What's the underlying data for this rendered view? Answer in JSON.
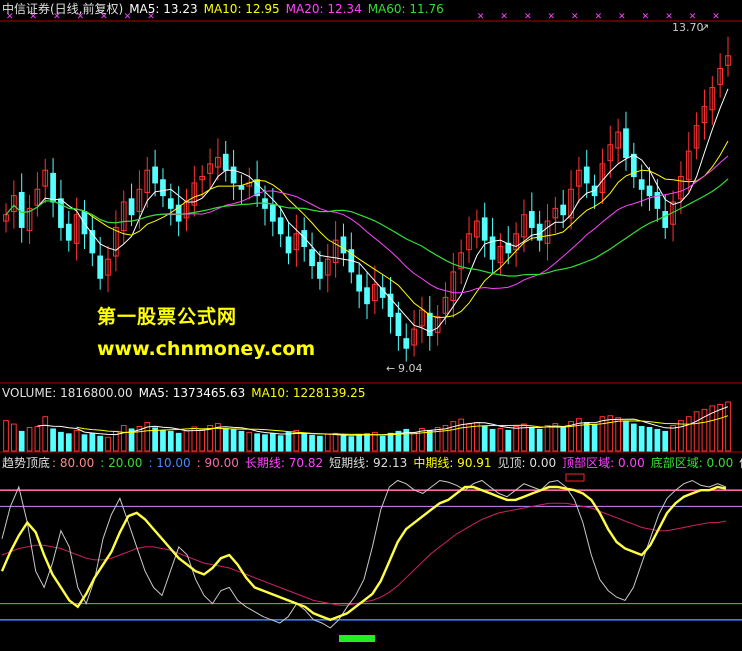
{
  "colors": {
    "bg": "#000000",
    "up": "#ff3333",
    "down": "#54ffff",
    "ma5": "#ffffff",
    "ma10": "#ffff00",
    "ma20": "#ff44ff",
    "ma60": "#33dd33",
    "divider": "#b00000"
  },
  "price_header": {
    "title": "中信证券(日线,前复权)",
    "ma5": "MA5: 13.23",
    "ma10": "MA10: 12.95",
    "ma20": "MA20: 12.34",
    "ma60": "MA60: 11.76"
  },
  "volume_header": {
    "title": "VOLUME: 1816800.00",
    "ma5": "MA5: 1373465.63",
    "ma10": "MA10: 1228139.25"
  },
  "indicator_header": {
    "title": "趋势顶底",
    "v1": ": 80.00",
    "v2": ": 20.00",
    "v3": ": 10.00",
    "v4": ": 90.00",
    "long": "长期线: 70.82",
    "short": "短期线: 92.13",
    "mid": "中期线: 90.91",
    "top": "见顶: 0.00",
    "top_zone": "顶部区域: 0.00",
    "bottom_zone": "底部区域: 0.00",
    "low": "低位"
  },
  "watermark": {
    "line1": "第一股票公式网",
    "line2": "www.chnmoney.com"
  },
  "chart_data": [
    {
      "type": "candlestick",
      "ylim": [
        8.6,
        14.2
      ],
      "max_label": "13.70",
      "min_label": "9.04",
      "close": [
        11.2,
        11.5,
        11.0,
        11.3,
        11.6,
        11.9,
        11.4,
        11.0,
        10.8,
        11.2,
        10.9,
        10.6,
        10.2,
        10.5,
        11.0,
        11.4,
        11.2,
        11.6,
        11.9,
        11.7,
        11.5,
        11.3,
        11.1,
        11.4,
        11.7,
        11.8,
        12.0,
        12.1,
        11.9,
        11.7,
        11.6,
        11.7,
        11.5,
        11.3,
        11.1,
        10.9,
        10.6,
        10.9,
        10.7,
        10.4,
        10.2,
        10.5,
        10.8,
        10.6,
        10.3,
        10.0,
        9.8,
        10.1,
        9.9,
        9.6,
        9.3,
        9.1,
        9.4,
        9.7,
        9.3,
        9.6,
        9.9,
        10.3,
        10.6,
        10.9,
        11.1,
        10.8,
        10.5,
        10.7,
        10.6,
        10.9,
        11.2,
        11.0,
        10.8,
        11.1,
        11.3,
        11.2,
        11.6,
        11.9,
        11.7,
        11.5,
        12.0,
        12.3,
        12.5,
        12.1,
        11.8,
        11.6,
        11.5,
        11.3,
        11.0,
        11.4,
        11.8,
        12.2,
        12.6,
        12.9,
        13.2,
        13.5,
        13.7
      ]
    },
    {
      "type": "bar",
      "values": [
        0.62,
        0.55,
        0.4,
        0.48,
        0.5,
        0.7,
        0.45,
        0.38,
        0.35,
        0.42,
        0.33,
        0.36,
        0.3,
        0.28,
        0.4,
        0.52,
        0.45,
        0.5,
        0.58,
        0.47,
        0.42,
        0.4,
        0.36,
        0.41,
        0.49,
        0.44,
        0.52,
        0.56,
        0.46,
        0.43,
        0.4,
        0.38,
        0.35,
        0.33,
        0.36,
        0.31,
        0.38,
        0.42,
        0.35,
        0.32,
        0.3,
        0.34,
        0.36,
        0.31,
        0.29,
        0.33,
        0.35,
        0.38,
        0.3,
        0.36,
        0.4,
        0.44,
        0.38,
        0.46,
        0.42,
        0.48,
        0.52,
        0.6,
        0.65,
        0.55,
        0.58,
        0.5,
        0.44,
        0.46,
        0.42,
        0.5,
        0.55,
        0.48,
        0.44,
        0.52,
        0.56,
        0.5,
        0.6,
        0.66,
        0.58,
        0.54,
        0.7,
        0.72,
        0.68,
        0.6,
        0.55,
        0.5,
        0.48,
        0.44,
        0.4,
        0.52,
        0.62,
        0.7,
        0.8,
        0.85,
        0.92,
        0.95,
        1.0
      ]
    },
    {
      "type": "line",
      "ylim": [
        0,
        100
      ],
      "levels": [
        90,
        80,
        20,
        10
      ],
      "mid": [
        40,
        52,
        62,
        70,
        64,
        50,
        38,
        30,
        22,
        18,
        26,
        36,
        44,
        52,
        64,
        74,
        76,
        72,
        66,
        60,
        54,
        48,
        44,
        40,
        38,
        42,
        48,
        50,
        44,
        36,
        30,
        28,
        26,
        24,
        22,
        20,
        18,
        14,
        12,
        10,
        12,
        14,
        18,
        22,
        26,
        34,
        46,
        58,
        66,
        70,
        74,
        78,
        82,
        84,
        88,
        92,
        92,
        90,
        88,
        86,
        84,
        84,
        86,
        88,
        90,
        92,
        92,
        91,
        90,
        88,
        84,
        76,
        66,
        58,
        54,
        52,
        50,
        56,
        66,
        76,
        82,
        86,
        88,
        90,
        90,
        92,
        91
      ],
      "short": [
        60,
        80,
        92,
        70,
        40,
        30,
        45,
        65,
        55,
        30,
        20,
        35,
        60,
        75,
        85,
        70,
        55,
        40,
        30,
        25,
        40,
        55,
        50,
        35,
        25,
        20,
        28,
        30,
        22,
        18,
        15,
        12,
        10,
        8,
        12,
        20,
        16,
        10,
        8,
        5,
        10,
        18,
        25,
        35,
        55,
        78,
        92,
        96,
        94,
        90,
        88,
        92,
        96,
        95,
        93,
        90,
        94,
        96,
        92,
        88,
        86,
        90,
        94,
        92,
        90,
        95,
        96,
        92,
        84,
        70,
        50,
        35,
        28,
        24,
        22,
        30,
        45,
        60,
        75,
        85,
        90,
        94,
        96,
        93,
        92,
        94,
        92
      ],
      "long": [
        50,
        52,
        54,
        55,
        56,
        56,
        55,
        54,
        52,
        50,
        48,
        47,
        47,
        48,
        50,
        52,
        54,
        55,
        55,
        54,
        53,
        51,
        49,
        47,
        45,
        44,
        43,
        42,
        40,
        38,
        36,
        34,
        32,
        30,
        28,
        26,
        24,
        22,
        21,
        20,
        19,
        19,
        20,
        21,
        22,
        24,
        27,
        31,
        36,
        41,
        46,
        51,
        55,
        59,
        63,
        66,
        69,
        72,
        74,
        76,
        77,
        78,
        79,
        80,
        81,
        82,
        82,
        82,
        81,
        80,
        79,
        77,
        75,
        73,
        71,
        69,
        67,
        66,
        65,
        65,
        66,
        67,
        68,
        69,
        70,
        70,
        71
      ]
    }
  ]
}
